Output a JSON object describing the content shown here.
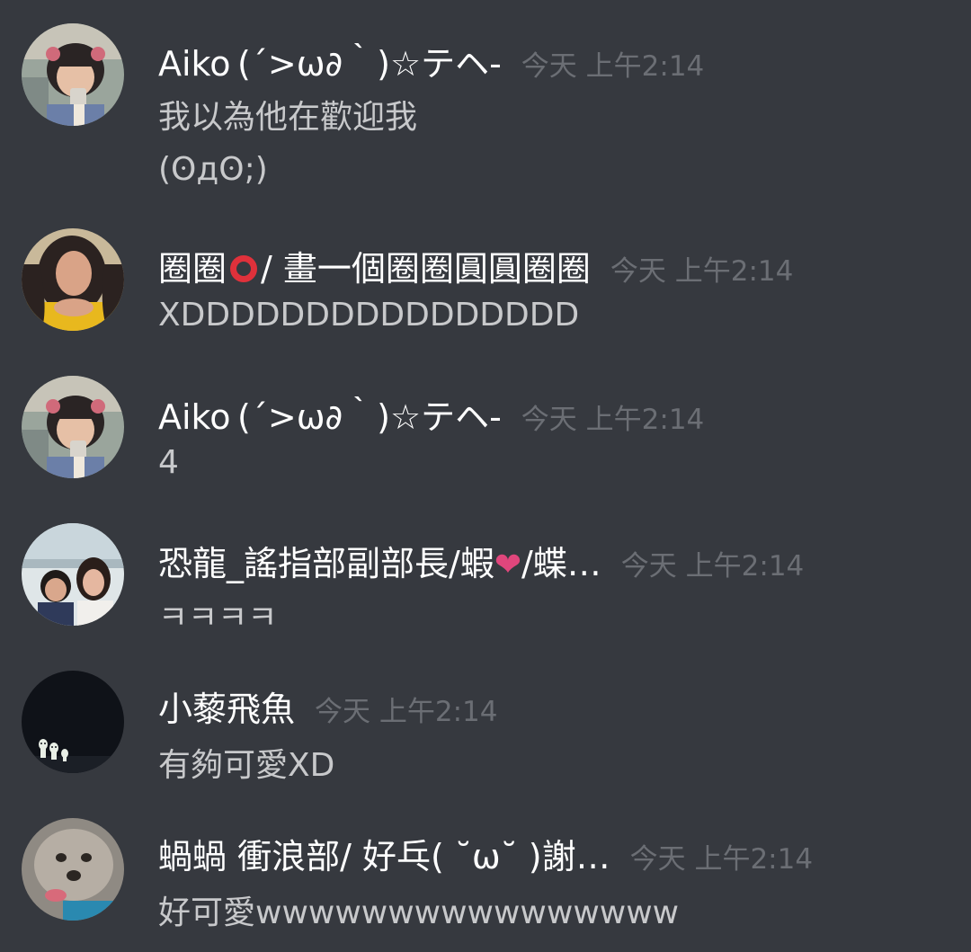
{
  "colors": {
    "background": "#36393f",
    "username": "#ffffff",
    "message_text": "#c8c9cb",
    "timestamp": "#6b6e74",
    "heart": "#e0467c",
    "ring": "#e0313b"
  },
  "messages": [
    {
      "author": "Aiko (´>ω∂｀)☆テヘ-",
      "timestamp": "今天 上午2:14",
      "avatar_icon": "girl-photo-avatar",
      "lines": [
        "我以為他在歡迎我",
        "(ʘдʘ;)"
      ]
    },
    {
      "author_part1": "圈圈",
      "author_emoji": "red-circle-icon",
      "author_part2": " / 畫一個圈圈圓圓圈圈",
      "timestamp": "今天 上午2:14",
      "avatar_icon": "woman-yellow-shirt-avatar",
      "lines": [
        "XDDDDDDDDDDDDDDDD"
      ]
    },
    {
      "author": "Aiko (´>ω∂｀)☆テヘ-",
      "timestamp": "今天 上午2:14",
      "avatar_icon": "girl-photo-avatar",
      "lines": [
        "4"
      ]
    },
    {
      "author_part1": "恐龍_謠指部副部長/蝦",
      "author_emoji": "heart-icon",
      "author_emoji_glyph": "❤",
      "author_part2": "/蝶…",
      "timestamp": "今天 上午2:14",
      "avatar_icon": "two-women-avatar",
      "lines": [
        "ㅋㅋㅋㅋ"
      ]
    },
    {
      "author": "小藜飛魚",
      "timestamp": "今天 上午2:14",
      "avatar_icon": "forest-spirits-avatar",
      "lines": [
        "有夠可愛XD"
      ]
    },
    {
      "author": "蝸蝸 衝浪部/ 好乓( ˘ω˘ )謝…",
      "timestamp": "今天 上午2:14",
      "avatar_icon": "dog-avatar",
      "lines": [
        "好可愛wwwwwwwwwwwwwwww"
      ]
    }
  ]
}
